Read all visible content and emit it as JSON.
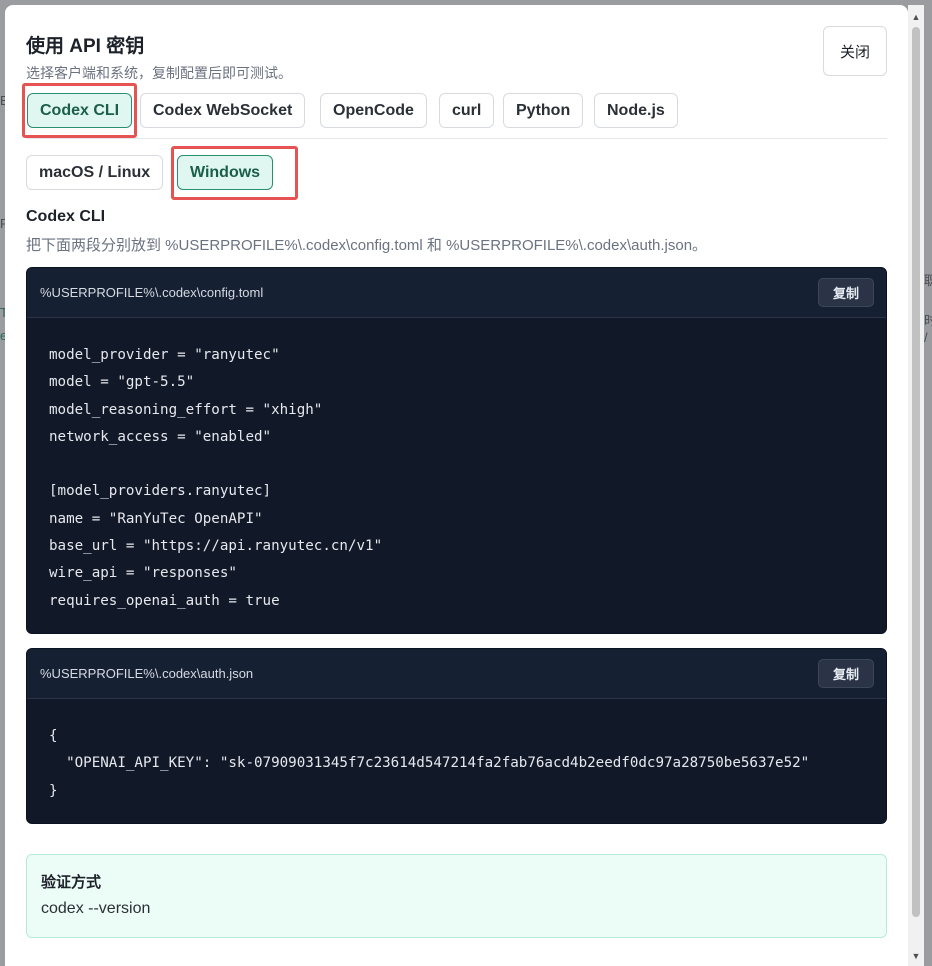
{
  "dialog": {
    "title": "使用 API 密钥",
    "subtitle": "选择客户端和系统，复制配置后即可测试。",
    "close_label": "关闭"
  },
  "client_tabs": [
    {
      "label": "Codex CLI",
      "active": true
    },
    {
      "label": "Codex WebSocket",
      "active": false
    },
    {
      "label": "OpenCode",
      "active": false
    },
    {
      "label": "curl",
      "active": false
    },
    {
      "label": "Python",
      "active": false
    },
    {
      "label": "Node.js",
      "active": false
    }
  ],
  "os_tabs": [
    {
      "label": "macOS / Linux",
      "active": false
    },
    {
      "label": "Windows",
      "active": true
    }
  ],
  "section": {
    "title": "Codex CLI",
    "description": "把下面两段分别放到 %USERPROFILE%\\.codex\\config.toml 和 %USERPROFILE%\\.codex\\auth.json。"
  },
  "config_block": {
    "path": "%USERPROFILE%\\.codex\\config.toml",
    "copy_label": "复制",
    "lines": [
      "model_provider = \"ranyutec\"",
      "model = \"gpt-5.5\"",
      "model_reasoning_effort = \"xhigh\"",
      "network_access = \"enabled\"",
      "",
      "[model_providers.ranyutec]",
      "name = \"RanYuTec OpenAPI\"",
      "base_url = \"https://api.ranyutec.cn/v1\"",
      "wire_api = \"responses\"",
      "requires_openai_auth = true"
    ]
  },
  "auth_block": {
    "path": "%USERPROFILE%\\.codex\\auth.json",
    "copy_label": "复制",
    "lines": [
      "{",
      "  \"OPENAI_API_KEY\": \"sk-07909031345f7c23614d547214fa2fab76acd4b2eedf0dc97a28750be5637e52\"",
      "}"
    ]
  },
  "verify": {
    "title": "验证方式",
    "command": "codex --version"
  },
  "colors": {
    "accent": "#2a8f6f",
    "accent_bg": "#dff7f0",
    "highlight": "#e55353",
    "code_bg": "#111827"
  }
}
